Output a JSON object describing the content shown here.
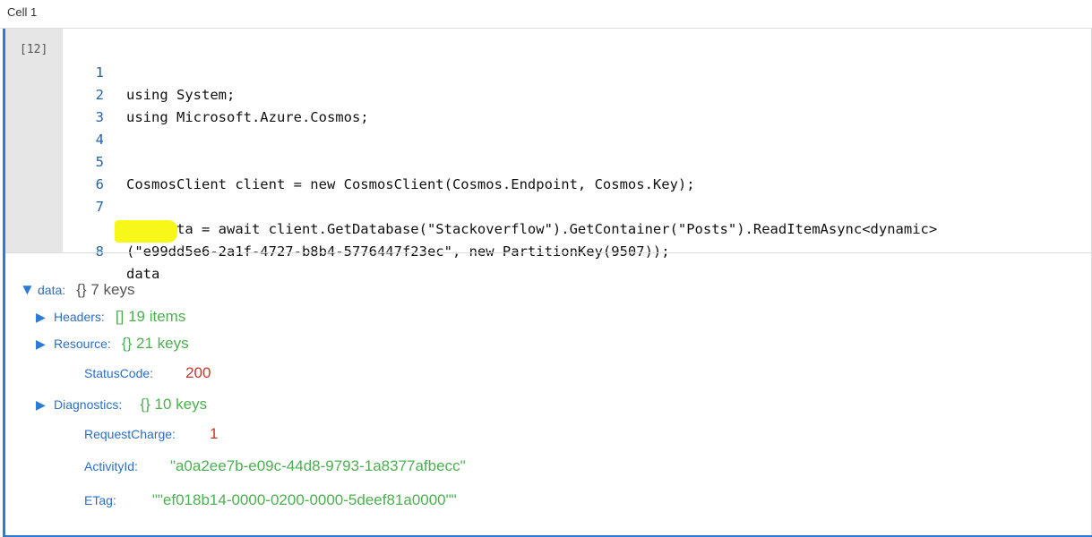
{
  "cell": {
    "title": "Cell 1",
    "execution_count": "[12]"
  },
  "code": {
    "lines": [
      {
        "no": "1",
        "text": "using System;"
      },
      {
        "no": "2",
        "text": "using Microsoft.Azure.Cosmos;"
      },
      {
        "no": "3",
        "text": ""
      },
      {
        "no": "4",
        "text": ""
      },
      {
        "no": "5",
        "text": "CosmosClient client = new CosmosClient(Cosmos.Endpoint, Cosmos.Key);"
      },
      {
        "no": "6",
        "text": ""
      },
      {
        "no": "7",
        "text": "var data = await client.GetDatabase(\"Stackoverflow\").GetContainer(\"Posts\").ReadItemAsync<dynamic>"
      },
      {
        "no": "",
        "text": "(\"e99dd5e6-2a1f-4727-b8b4-5776447f23ec\", new PartitionKey(9507));"
      },
      {
        "no": "8",
        "text": "data"
      }
    ]
  },
  "output": {
    "root": {
      "key": "data:",
      "meta": "{}  7 keys"
    },
    "items": [
      {
        "key": "Headers:",
        "meta": "[]  19 items"
      },
      {
        "key": "Resource:",
        "meta": "{}  21 keys"
      },
      {
        "key": "StatusCode:",
        "value": "200"
      },
      {
        "key": "Diagnostics:",
        "meta": "{}  10 keys"
      },
      {
        "key": "RequestCharge:",
        "value": "1"
      },
      {
        "key": "ActivityId:",
        "value": "\"a0a2ee7b-e09c-44d8-9793-1a8377afbecc\""
      },
      {
        "key": "ETag:",
        "value": "\"\"ef018b14-0000-0200-0000-5deef81a0000\"\""
      }
    ]
  },
  "colors": {
    "accent": "#2b7bd6",
    "highlight": "#f7f71a",
    "key": "#2b6fc4",
    "number": "#c0392b",
    "string": "#4caf50"
  },
  "icons": {
    "expanded": "triangle-down-icon",
    "collapsed": "triangle-right-icon"
  }
}
